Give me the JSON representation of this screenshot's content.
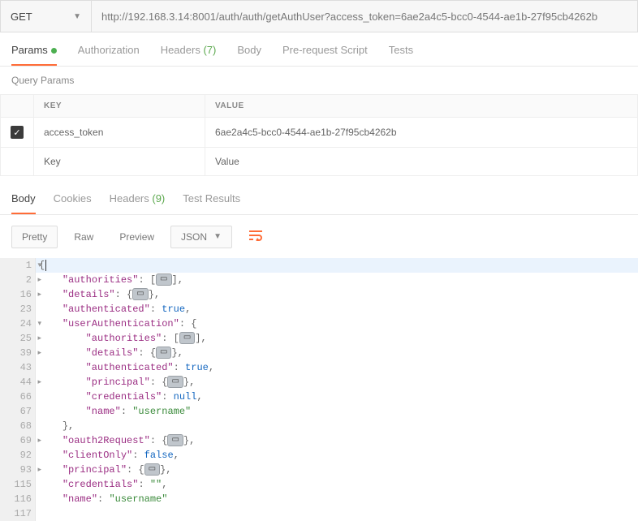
{
  "request": {
    "method": "GET",
    "url": "http://192.168.3.14:8001/auth/auth/getAuthUser?access_token=6ae2a4c5-bcc0-4544-ae1b-27f95cb4262b"
  },
  "reqTabs": {
    "params": "Params",
    "authorization": "Authorization",
    "headers": "Headers",
    "headersCount": "(7)",
    "body": "Body",
    "prereq": "Pre-request Script",
    "tests": "Tests"
  },
  "queryParams": {
    "title": "Query Params",
    "headKey": "KEY",
    "headValue": "VALUE",
    "rows": [
      {
        "checked": true,
        "key": "access_token",
        "value": "6ae2a4c5-bcc0-4544-ae1b-27f95cb4262b"
      }
    ],
    "phKey": "Key",
    "phValue": "Value"
  },
  "respTabs": {
    "body": "Body",
    "cookies": "Cookies",
    "headers": "Headers",
    "headersCount": "(9)",
    "testResults": "Test Results"
  },
  "toolbar": {
    "pretty": "Pretty",
    "raw": "Raw",
    "preview": "Preview",
    "format": "JSON"
  },
  "code": {
    "lines": [
      {
        "n": "1",
        "indent": 0,
        "open": "{",
        "fold": "v",
        "hl": true
      },
      {
        "n": "2",
        "indent": 1,
        "key": "authorities",
        "after": ": [",
        "pill": true,
        "close": "],",
        "fold": ">"
      },
      {
        "n": "16",
        "indent": 1,
        "key": "details",
        "after": ": {",
        "pill": true,
        "close": "},",
        "fold": ">"
      },
      {
        "n": "23",
        "indent": 1,
        "key": "authenticated",
        "bool": "true",
        "comma": true
      },
      {
        "n": "24",
        "indent": 1,
        "key": "userAuthentication",
        "after": ": {",
        "fold": "v"
      },
      {
        "n": "25",
        "indent": 2,
        "key": "authorities",
        "after": ": [",
        "pill": true,
        "close": "],",
        "fold": ">"
      },
      {
        "n": "39",
        "indent": 2,
        "key": "details",
        "after": ": {",
        "pill": true,
        "close": "},",
        "fold": ">"
      },
      {
        "n": "43",
        "indent": 2,
        "key": "authenticated",
        "bool": "true",
        "comma": true
      },
      {
        "n": "44",
        "indent": 2,
        "key": "principal",
        "after": ": {",
        "pill": true,
        "close": "},",
        "fold": ">"
      },
      {
        "n": "66",
        "indent": 2,
        "key": "credentials",
        "nullv": "null",
        "comma": true
      },
      {
        "n": "67",
        "indent": 2,
        "key": "name",
        "str": "username"
      },
      {
        "n": "68",
        "indent": 1,
        "closeOnly": "},"
      },
      {
        "n": "69",
        "indent": 1,
        "key": "oauth2Request",
        "after": ": {",
        "pill": true,
        "close": "},",
        "fold": ">"
      },
      {
        "n": "92",
        "indent": 1,
        "key": "clientOnly",
        "bool": "false",
        "comma": true
      },
      {
        "n": "93",
        "indent": 1,
        "key": "principal",
        "after": ": {",
        "pill": true,
        "close": "},",
        "fold": ">"
      },
      {
        "n": "115",
        "indent": 1,
        "key": "credentials",
        "str": "",
        "comma": true
      },
      {
        "n": "116",
        "indent": 1,
        "key": "name",
        "str": "username"
      },
      {
        "n": "117",
        "indent": 0,
        "closeOnly": ""
      }
    ]
  }
}
